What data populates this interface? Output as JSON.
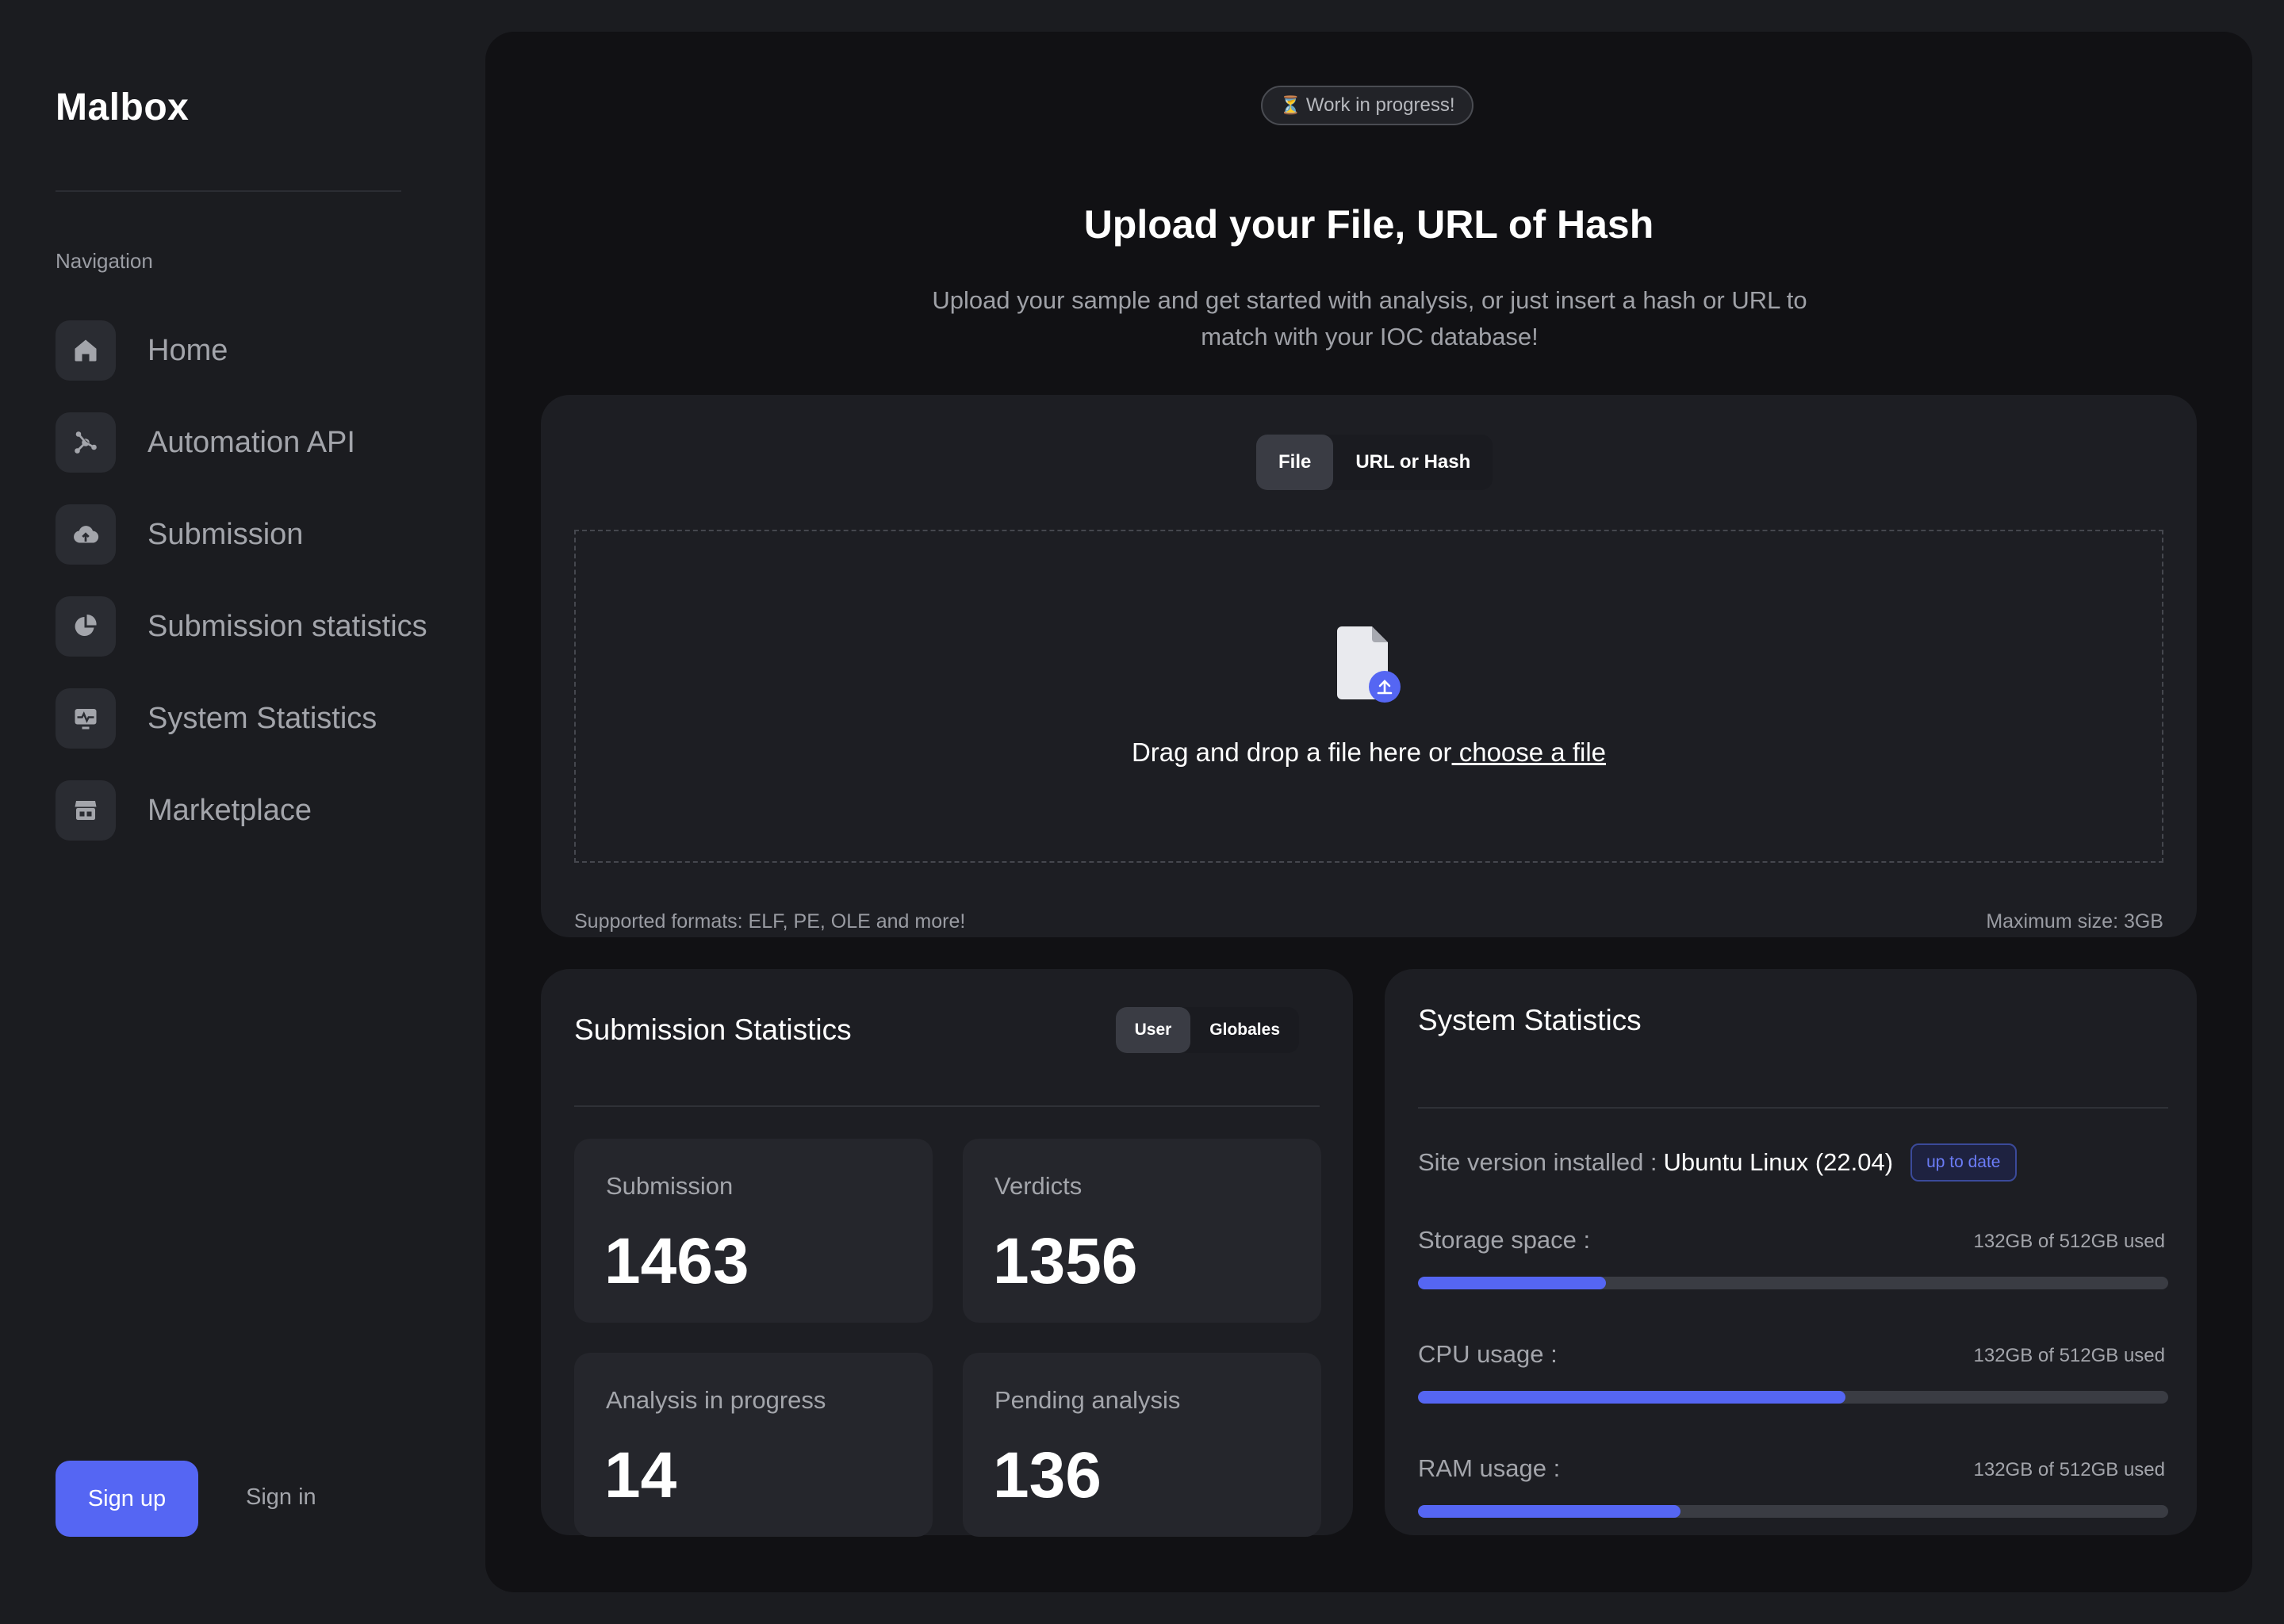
{
  "app": {
    "name": "Malbox"
  },
  "sidebar": {
    "heading": "Navigation",
    "items": [
      {
        "label": "Home",
        "icon": "home-icon"
      },
      {
        "label": "Automation API",
        "icon": "api-icon"
      },
      {
        "label": "Submission",
        "icon": "cloud-upload-icon"
      },
      {
        "label": "Submission statistics",
        "icon": "pie-chart-icon"
      },
      {
        "label": "System Statistics",
        "icon": "monitor-pulse-icon"
      },
      {
        "label": "Marketplace",
        "icon": "store-icon"
      }
    ],
    "signup_label": "Sign up",
    "signin_label": "Sign in"
  },
  "hero": {
    "badge_emoji": "⏳",
    "badge_text": "Work in progress!",
    "title": "Upload your File, URL of Hash",
    "subtitle": "Upload your sample and get started with analysis, or just insert a hash or URL to match with your IOC database!"
  },
  "upload": {
    "tabs": [
      {
        "label": "File",
        "active": true
      },
      {
        "label": "URL or Hash",
        "active": false
      }
    ],
    "drop_text": "Drag and drop a file here or",
    "choose_link": " choose a file",
    "formats": "Supported formats: ELF, PE, OLE and more!",
    "max_size": "Maximum size: 3GB"
  },
  "submission_stats": {
    "title": "Submission Statistics",
    "tabs": [
      {
        "label": "User",
        "active": true
      },
      {
        "label": "Globales",
        "active": false
      }
    ],
    "boxes": [
      {
        "label": "Submission",
        "value": "1463"
      },
      {
        "label": "Verdicts",
        "value": "1356"
      },
      {
        "label": "Analysis in progress",
        "value": "14"
      },
      {
        "label": "Pending analysis",
        "value": "136"
      }
    ]
  },
  "system_stats": {
    "title": "System Statistics",
    "version_label": "Site version installed :",
    "version_value": "Ubuntu Linux (22.04)",
    "version_badge": "up to date",
    "usages": [
      {
        "label": "Storage space :",
        "value": "132GB of 512GB used",
        "fraction": 0.25
      },
      {
        "label": "CPU usage :",
        "value": "132GB of 512GB used",
        "fraction": 0.57
      },
      {
        "label": "RAM usage :",
        "value": "132GB of 512GB used",
        "fraction": 0.35
      }
    ]
  },
  "colors": {
    "accent": "#5566f3",
    "background": "#1b1c20",
    "panel": "#111114",
    "card": "#1d1e23"
  }
}
